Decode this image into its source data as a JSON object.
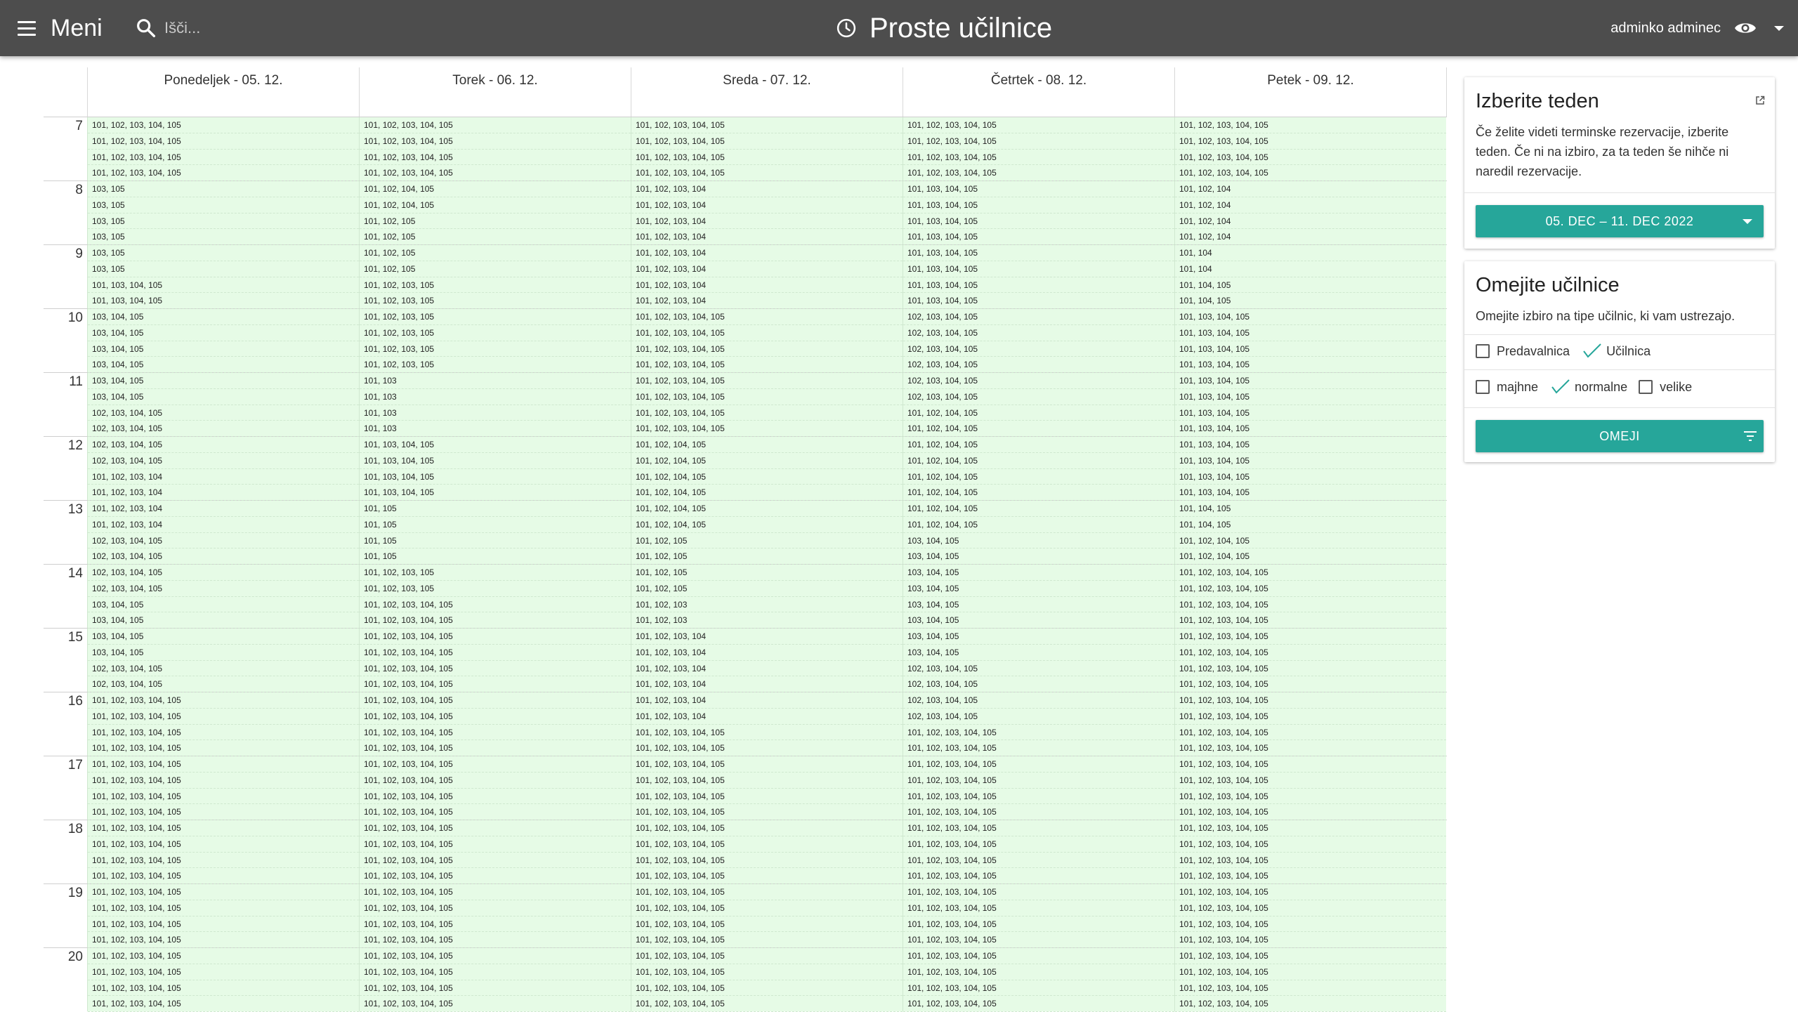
{
  "header": {
    "menu_label": "Meni",
    "search_placeholder": "Išči...",
    "title": "Proste učilnice",
    "user_name": "adminko adminec"
  },
  "calendar": {
    "days": [
      "Ponedeljek - 05. 12.",
      "Torek - 06. 12.",
      "Sreda - 07. 12.",
      "Četrtek - 08. 12.",
      "Petek - 09. 12."
    ],
    "hours": [
      "7",
      "8",
      "9",
      "10",
      "11",
      "12",
      "13",
      "14",
      "15",
      "16",
      "17",
      "18",
      "19",
      "20"
    ],
    "slots": [
      [
        [
          "101, 102, 103, 104, 105",
          "101, 102, 103, 104, 105",
          "101, 102, 103, 104, 105",
          "101, 102, 103, 104, 105"
        ],
        [
          "103, 105",
          "103, 105",
          "103, 105",
          "103, 105"
        ],
        [
          "103, 105",
          "103, 105",
          "101, 103, 104, 105",
          "101, 103, 104, 105"
        ],
        [
          "103, 104, 105",
          "103, 104, 105",
          "103, 104, 105",
          "103, 104, 105"
        ],
        [
          "103, 104, 105",
          "103, 104, 105",
          "102, 103, 104, 105",
          "102, 103, 104, 105"
        ],
        [
          "102, 103, 104, 105",
          "102, 103, 104, 105",
          "101, 102, 103, 104",
          "101, 102, 103, 104"
        ],
        [
          "101, 102, 103, 104",
          "101, 102, 103, 104",
          "102, 103, 104, 105",
          "102, 103, 104, 105"
        ],
        [
          "102, 103, 104, 105",
          "102, 103, 104, 105",
          "103, 104, 105",
          "103, 104, 105"
        ],
        [
          "103, 104, 105",
          "103, 104, 105",
          "102, 103, 104, 105",
          "102, 103, 104, 105"
        ],
        [
          "101, 102, 103, 104, 105",
          "101, 102, 103, 104, 105",
          "101, 102, 103, 104, 105",
          "101, 102, 103, 104, 105"
        ],
        [
          "101, 102, 103, 104, 105",
          "101, 102, 103, 104, 105",
          "101, 102, 103, 104, 105",
          "101, 102, 103, 104, 105"
        ],
        [
          "101, 102, 103, 104, 105",
          "101, 102, 103, 104, 105",
          "101, 102, 103, 104, 105",
          "101, 102, 103, 104, 105"
        ],
        [
          "101, 102, 103, 104, 105",
          "101, 102, 103, 104, 105",
          "101, 102, 103, 104, 105",
          "101, 102, 103, 104, 105"
        ],
        [
          "101, 102, 103, 104, 105",
          "101, 102, 103, 104, 105",
          "101, 102, 103, 104, 105",
          "101, 102, 103, 104, 105"
        ]
      ],
      [
        [
          "101, 102, 103, 104, 105",
          "101, 102, 103, 104, 105",
          "101, 102, 103, 104, 105",
          "101, 102, 103, 104, 105"
        ],
        [
          "101, 102, 104, 105",
          "101, 102, 104, 105",
          "101, 102, 105",
          "101, 102, 105"
        ],
        [
          "101, 102, 105",
          "101, 102, 105",
          "101, 102, 103, 105",
          "101, 102, 103, 105"
        ],
        [
          "101, 102, 103, 105",
          "101, 102, 103, 105",
          "101, 102, 103, 105",
          "101, 102, 103, 105"
        ],
        [
          "101, 103",
          "101, 103",
          "101, 103",
          "101, 103"
        ],
        [
          "101, 103, 104, 105",
          "101, 103, 104, 105",
          "101, 103, 104, 105",
          "101, 103, 104, 105"
        ],
        [
          "101, 105",
          "101, 105",
          "101, 105",
          "101, 105"
        ],
        [
          "101, 102, 103, 105",
          "101, 102, 103, 105",
          "101, 102, 103, 104, 105",
          "101, 102, 103, 104, 105"
        ],
        [
          "101, 102, 103, 104, 105",
          "101, 102, 103, 104, 105",
          "101, 102, 103, 104, 105",
          "101, 102, 103, 104, 105"
        ],
        [
          "101, 102, 103, 104, 105",
          "101, 102, 103, 104, 105",
          "101, 102, 103, 104, 105",
          "101, 102, 103, 104, 105"
        ],
        [
          "101, 102, 103, 104, 105",
          "101, 102, 103, 104, 105",
          "101, 102, 103, 104, 105",
          "101, 102, 103, 104, 105"
        ],
        [
          "101, 102, 103, 104, 105",
          "101, 102, 103, 104, 105",
          "101, 102, 103, 104, 105",
          "101, 102, 103, 104, 105"
        ],
        [
          "101, 102, 103, 104, 105",
          "101, 102, 103, 104, 105",
          "101, 102, 103, 104, 105",
          "101, 102, 103, 104, 105"
        ],
        [
          "101, 102, 103, 104, 105",
          "101, 102, 103, 104, 105",
          "101, 102, 103, 104, 105",
          "101, 102, 103, 104, 105"
        ]
      ],
      [
        [
          "101, 102, 103, 104, 105",
          "101, 102, 103, 104, 105",
          "101, 102, 103, 104, 105",
          "101, 102, 103, 104, 105"
        ],
        [
          "101, 102, 103, 104",
          "101, 102, 103, 104",
          "101, 102, 103, 104",
          "101, 102, 103, 104"
        ],
        [
          "101, 102, 103, 104",
          "101, 102, 103, 104",
          "101, 102, 103, 104",
          "101, 102, 103, 104"
        ],
        [
          "101, 102, 103, 104, 105",
          "101, 102, 103, 104, 105",
          "101, 102, 103, 104, 105",
          "101, 102, 103, 104, 105"
        ],
        [
          "101, 102, 103, 104, 105",
          "101, 102, 103, 104, 105",
          "101, 102, 103, 104, 105",
          "101, 102, 103, 104, 105"
        ],
        [
          "101, 102, 104, 105",
          "101, 102, 104, 105",
          "101, 102, 104, 105",
          "101, 102, 104, 105"
        ],
        [
          "101, 102, 104, 105",
          "101, 102, 104, 105",
          "101, 102, 105",
          "101, 102, 105"
        ],
        [
          "101, 102, 105",
          "101, 102, 105",
          "101, 102, 103",
          "101, 102, 103"
        ],
        [
          "101, 102, 103, 104",
          "101, 102, 103, 104",
          "101, 102, 103, 104",
          "101, 102, 103, 104"
        ],
        [
          "101, 102, 103, 104",
          "101, 102, 103, 104",
          "101, 102, 103, 104, 105",
          "101, 102, 103, 104, 105"
        ],
        [
          "101, 102, 103, 104, 105",
          "101, 102, 103, 104, 105",
          "101, 102, 103, 104, 105",
          "101, 102, 103, 104, 105"
        ],
        [
          "101, 102, 103, 104, 105",
          "101, 102, 103, 104, 105",
          "101, 102, 103, 104, 105",
          "101, 102, 103, 104, 105"
        ],
        [
          "101, 102, 103, 104, 105",
          "101, 102, 103, 104, 105",
          "101, 102, 103, 104, 105",
          "101, 102, 103, 104, 105"
        ],
        [
          "101, 102, 103, 104, 105",
          "101, 102, 103, 104, 105",
          "101, 102, 103, 104, 105",
          "101, 102, 103, 104, 105"
        ]
      ],
      [
        [
          "101, 102, 103, 104, 105",
          "101, 102, 103, 104, 105",
          "101, 102, 103, 104, 105",
          "101, 102, 103, 104, 105"
        ],
        [
          "101, 103, 104, 105",
          "101, 103, 104, 105",
          "101, 103, 104, 105",
          "101, 103, 104, 105"
        ],
        [
          "101, 103, 104, 105",
          "101, 103, 104, 105",
          "101, 103, 104, 105",
          "101, 103, 104, 105"
        ],
        [
          "102, 103, 104, 105",
          "102, 103, 104, 105",
          "102, 103, 104, 105",
          "102, 103, 104, 105"
        ],
        [
          "102, 103, 104, 105",
          "102, 103, 104, 105",
          "101, 102, 104, 105",
          "101, 102, 104, 105"
        ],
        [
          "101, 102, 104, 105",
          "101, 102, 104, 105",
          "101, 102, 104, 105",
          "101, 102, 104, 105"
        ],
        [
          "101, 102, 104, 105",
          "101, 102, 104, 105",
          "103, 104, 105",
          "103, 104, 105"
        ],
        [
          "103, 104, 105",
          "103, 104, 105",
          "103, 104, 105",
          "103, 104, 105"
        ],
        [
          "103, 104, 105",
          "103, 104, 105",
          "102, 103, 104, 105",
          "102, 103, 104, 105"
        ],
        [
          "102, 103, 104, 105",
          "102, 103, 104, 105",
          "101, 102, 103, 104, 105",
          "101, 102, 103, 104, 105"
        ],
        [
          "101, 102, 103, 104, 105",
          "101, 102, 103, 104, 105",
          "101, 102, 103, 104, 105",
          "101, 102, 103, 104, 105"
        ],
        [
          "101, 102, 103, 104, 105",
          "101, 102, 103, 104, 105",
          "101, 102, 103, 104, 105",
          "101, 102, 103, 104, 105"
        ],
        [
          "101, 102, 103, 104, 105",
          "101, 102, 103, 104, 105",
          "101, 102, 103, 104, 105",
          "101, 102, 103, 104, 105"
        ],
        [
          "101, 102, 103, 104, 105",
          "101, 102, 103, 104, 105",
          "101, 102, 103, 104, 105",
          "101, 102, 103, 104, 105"
        ]
      ],
      [
        [
          "101, 102, 103, 104, 105",
          "101, 102, 103, 104, 105",
          "101, 102, 103, 104, 105",
          "101, 102, 103, 104, 105"
        ],
        [
          "101, 102, 104",
          "101, 102, 104",
          "101, 102, 104",
          "101, 102, 104"
        ],
        [
          "101, 104",
          "101, 104",
          "101, 104, 105",
          "101, 104, 105"
        ],
        [
          "101, 103, 104, 105",
          "101, 103, 104, 105",
          "101, 103, 104, 105",
          "101, 103, 104, 105"
        ],
        [
          "101, 103, 104, 105",
          "101, 103, 104, 105",
          "101, 103, 104, 105",
          "101, 103, 104, 105"
        ],
        [
          "101, 103, 104, 105",
          "101, 103, 104, 105",
          "101, 103, 104, 105",
          "101, 103, 104, 105"
        ],
        [
          "101, 104, 105",
          "101, 104, 105",
          "101, 102, 104, 105",
          "101, 102, 104, 105"
        ],
        [
          "101, 102, 103, 104, 105",
          "101, 102, 103, 104, 105",
          "101, 102, 103, 104, 105",
          "101, 102, 103, 104, 105"
        ],
        [
          "101, 102, 103, 104, 105",
          "101, 102, 103, 104, 105",
          "101, 102, 103, 104, 105",
          "101, 102, 103, 104, 105"
        ],
        [
          "101, 102, 103, 104, 105",
          "101, 102, 103, 104, 105",
          "101, 102, 103, 104, 105",
          "101, 102, 103, 104, 105"
        ],
        [
          "101, 102, 103, 104, 105",
          "101, 102, 103, 104, 105",
          "101, 102, 103, 104, 105",
          "101, 102, 103, 104, 105"
        ],
        [
          "101, 102, 103, 104, 105",
          "101, 102, 103, 104, 105",
          "101, 102, 103, 104, 105",
          "101, 102, 103, 104, 105"
        ],
        [
          "101, 102, 103, 104, 105",
          "101, 102, 103, 104, 105",
          "101, 102, 103, 104, 105",
          "101, 102, 103, 104, 105"
        ],
        [
          "101, 102, 103, 104, 105",
          "101, 102, 103, 104, 105",
          "101, 102, 103, 104, 105",
          "101, 102, 103, 104, 105"
        ]
      ]
    ]
  },
  "week_card": {
    "title": "Izberite teden",
    "description": "Če želite videti terminske rezervacije, izberite teden. Če ni na izbiro, za ta teden še nihče ni naredil rezervacije.",
    "week_button": "05. DEC – 11. DEC 2022"
  },
  "filter_card": {
    "title": "Omejite učilnice",
    "description": "Omejite izbiro na tipe učilnic, ki vam ustrezajo.",
    "type_options": [
      {
        "label": "Predavalnica",
        "checked": false
      },
      {
        "label": "Učilnica",
        "checked": true
      }
    ],
    "size_options": [
      {
        "label": "majhne",
        "checked": false
      },
      {
        "label": "normalne",
        "checked": true
      },
      {
        "label": "velike",
        "checked": false
      }
    ],
    "apply_button": "OMEJI"
  },
  "colors": {
    "topbar": "#4d4d4d",
    "accent": "#26a69a",
    "free_slot": "#e6fbe6"
  }
}
